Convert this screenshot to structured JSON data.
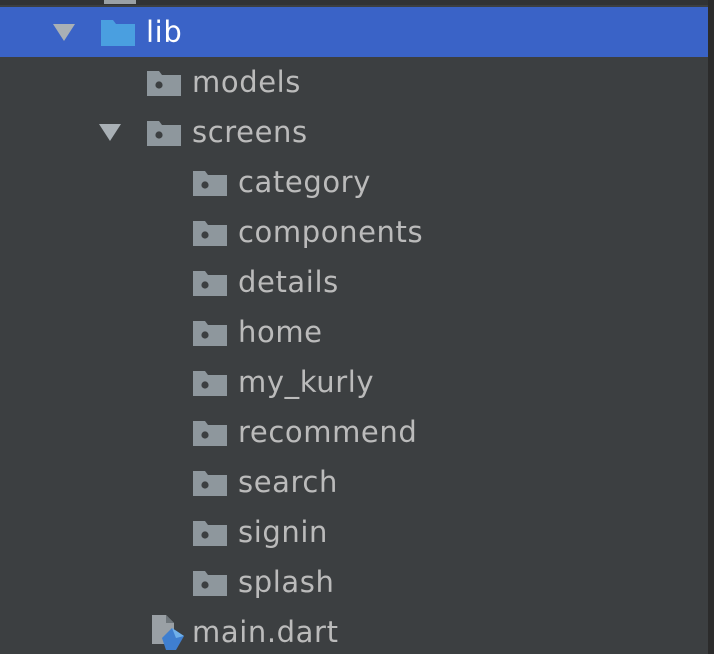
{
  "tree": {
    "root": {
      "label": "lib",
      "expanded": true,
      "selected": true
    },
    "items": [
      {
        "label": "models",
        "type": "folder",
        "depth": 1
      },
      {
        "label": "screens",
        "type": "folder",
        "depth": 1,
        "expanded": true
      },
      {
        "label": "category",
        "type": "folder",
        "depth": 2
      },
      {
        "label": "components",
        "type": "folder",
        "depth": 2
      },
      {
        "label": "details",
        "type": "folder",
        "depth": 2
      },
      {
        "label": "home",
        "type": "folder",
        "depth": 2
      },
      {
        "label": "my_kurly",
        "type": "folder",
        "depth": 2
      },
      {
        "label": "recommend",
        "type": "folder",
        "depth": 2
      },
      {
        "label": "search",
        "type": "folder",
        "depth": 2
      },
      {
        "label": "signin",
        "type": "folder",
        "depth": 2
      },
      {
        "label": "splash",
        "type": "folder",
        "depth": 2
      },
      {
        "label": "main.dart",
        "type": "dart-file",
        "depth": 1
      }
    ]
  },
  "colors": {
    "background": "#3c3f41",
    "selection": "#3a63c7",
    "text": "#bbbbbb",
    "folder_icon": "#8e979d",
    "source_folder_icon": "#4a9fe0",
    "dart_blue": "#3f7fd0"
  },
  "icons": {
    "expand": "triangle-down-icon",
    "source_folder": "source-folder-icon",
    "folder": "folder-icon",
    "dart_file": "dart-file-icon"
  }
}
